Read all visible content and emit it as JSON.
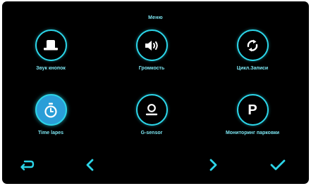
{
  "header": {
    "title": "Меню"
  },
  "menu": {
    "items": [
      {
        "label": "Звук кнопок",
        "icon": "button-sound-icon",
        "selected": false
      },
      {
        "label": "Громкость",
        "icon": "volume-icon",
        "selected": false
      },
      {
        "label": "Цикл.Записи",
        "icon": "loop-recording-icon",
        "selected": false
      },
      {
        "label": "Time lapes",
        "icon": "timer-icon",
        "selected": true
      },
      {
        "label": "G-sensor",
        "icon": "g-sensor-icon",
        "selected": false
      },
      {
        "label": "Мониторинг парковки",
        "icon": "parking-p-icon",
        "p_letter": "P",
        "selected": false
      }
    ]
  },
  "footer": {
    "buttons": [
      {
        "icon": "back-return-icon"
      },
      {
        "icon": "chevron-left-icon"
      },
      {
        "icon": "chevron-right-icon"
      },
      {
        "icon": "checkmark-icon"
      }
    ]
  },
  "colors": {
    "background": "#000000",
    "accent": "#2cd5e8",
    "text": "#7de6f2",
    "selected_fill": "#2a9ed8"
  }
}
